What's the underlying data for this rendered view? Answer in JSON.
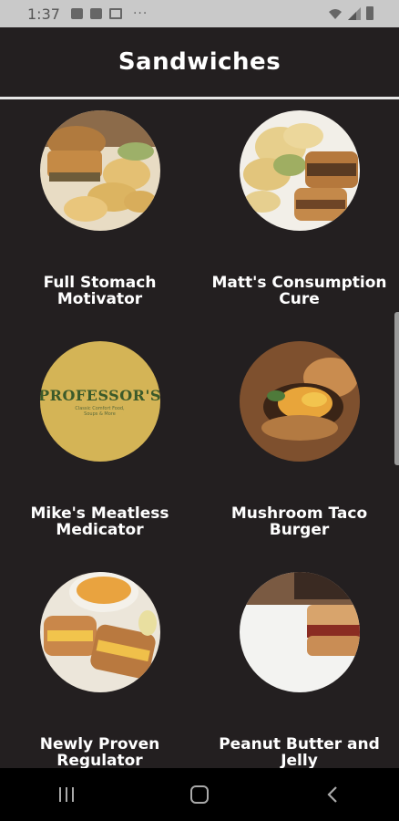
{
  "status_bar": {
    "time": "1:37",
    "dots": "···"
  },
  "header": {
    "title": "Sandwiches"
  },
  "items": [
    {
      "title": "Full Stomach Motivator"
    },
    {
      "title": "Matt's Consumption Cure"
    },
    {
      "title": "Mike's Meatless Medicator"
    },
    {
      "title": "Mushroom Taco Burger"
    },
    {
      "title": "Newly Proven Regulator"
    },
    {
      "title": "Peanut Butter and Jelly"
    }
  ],
  "logo": {
    "name": "PROFESSOR'S",
    "tagline": "Classic Comfort Food, Soups & More"
  },
  "colors": {
    "background": "#231f20",
    "accent_logo": "#d4b456",
    "logo_text": "#3b5a2a"
  }
}
